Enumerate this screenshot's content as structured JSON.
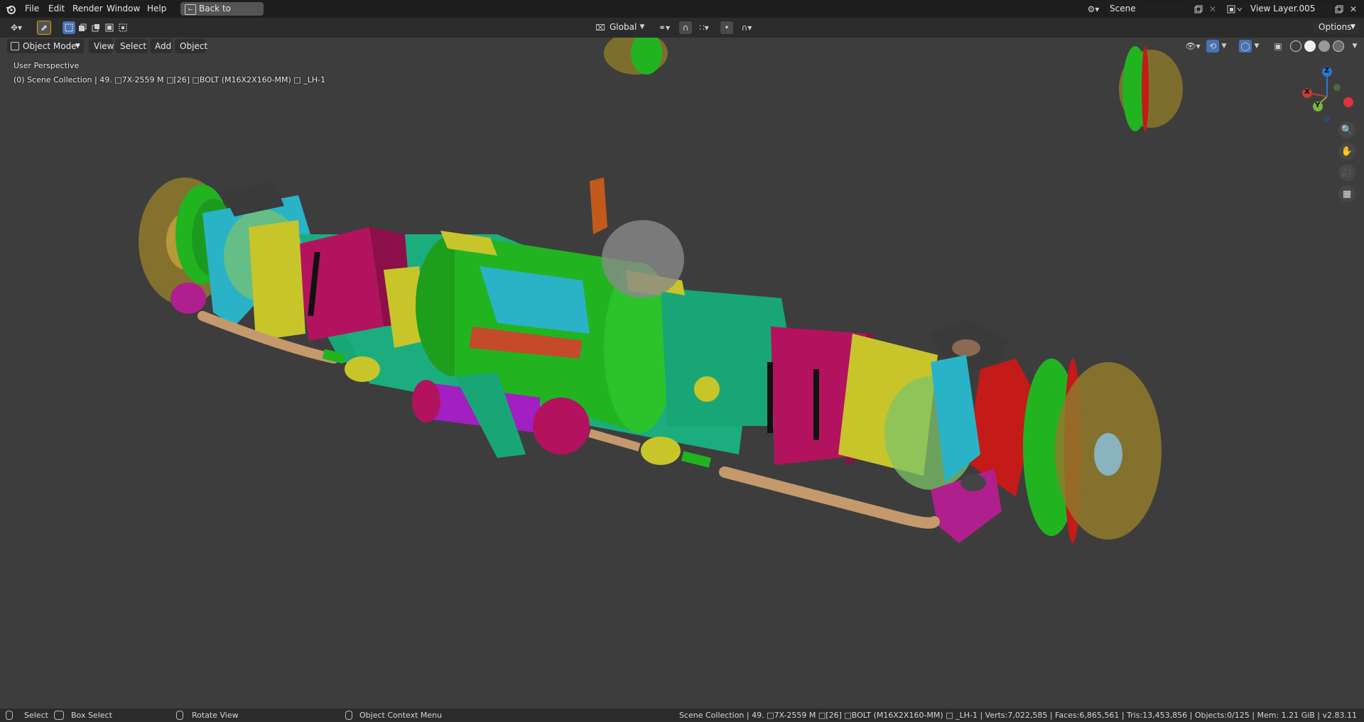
{
  "menubar": {
    "items": [
      "File",
      "Edit",
      "Render",
      "Window",
      "Help"
    ],
    "back_button": "Back to Previous",
    "scene_name": "Scene",
    "view_layer": "View Layer.005"
  },
  "toolbar": {
    "orientation": "Global",
    "options_label": "Options"
  },
  "viewport_header": {
    "mode": "Object Mode",
    "menus": [
      "View",
      "Select",
      "Add",
      "Object"
    ]
  },
  "viewport": {
    "perspective": "User Perspective",
    "collection_info": "(0) Scene Collection | 49. □7X-2559 M □[26] □BOLT (M16X2X160-MM) □ _LH-1",
    "gizmo": {
      "x_label": "X",
      "y_label": "Y",
      "z_label": "Z"
    },
    "colors": {
      "green": "#22b321",
      "teal": "#19a677",
      "magenta": "#b3135e",
      "yellow": "#c8c52a",
      "cyan": "#2ab3c6",
      "red": "#c41a18",
      "purple": "#a21fc2",
      "tan": "#c49a6c",
      "gold": "#8f7a2a"
    }
  },
  "statusbar": {
    "select": "Select",
    "box_select": "Box Select",
    "rotate_view": "Rotate View",
    "context_menu": "Object Context Menu",
    "stats": "Scene Collection | 49. □7X-2559 M □[26] □BOLT (M16X2X160-MM) □ _LH-1 | Verts:7,022,585 | Faces:6,865,561 | Tris:13,453,856 | Objects:0/125 | Mem: 1.21 GiB | v2.83.11"
  },
  "icons": [
    "blender-logo-icon",
    "back-icon",
    "scene-icon",
    "copy-icon",
    "close-icon",
    "view-layer-icon",
    "editor-type-icon",
    "select-cursor-icon",
    "transform-orientation-icon",
    "pivot-icon",
    "snap-icon",
    "proportional-icon",
    "visibility-icon",
    "gizmo-icon",
    "overlay-icon",
    "xray-icon",
    "wireframe-icon",
    "solid-icon",
    "material-icon",
    "rendered-icon",
    "zoom-icon",
    "pan-icon",
    "camera-icon",
    "grid-icon",
    "mouse-left-icon",
    "mouse-middle-icon",
    "mouse-right-icon"
  ]
}
